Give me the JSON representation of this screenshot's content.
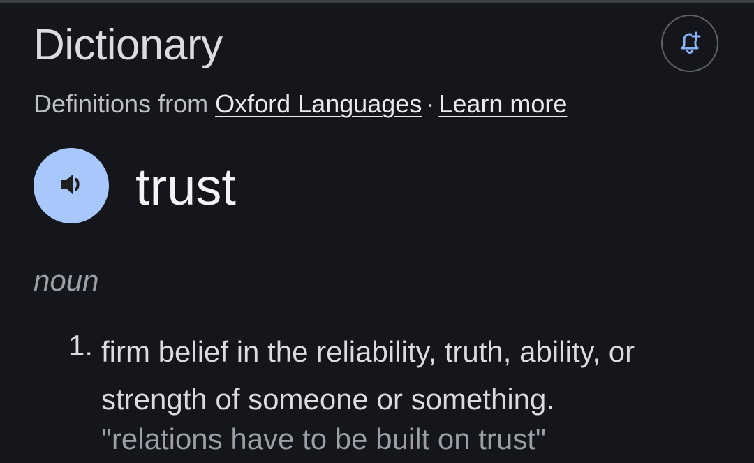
{
  "header": {
    "title": "Dictionary",
    "alert_icon": "bell-plus-icon"
  },
  "source": {
    "prefix": "Definitions from",
    "provider_link": "Oxford Languages",
    "separator": "·",
    "learn_more_link": "Learn more"
  },
  "entry": {
    "speaker_icon": "speaker-icon",
    "word": "trust",
    "part_of_speech": "noun",
    "senses": [
      {
        "number": "1.",
        "definition": "firm belief in the reliability, truth, ability, or strength of someone or something.",
        "example": "\"relations have to be built on trust\""
      }
    ]
  },
  "colors": {
    "background": "#15161b",
    "speaker_button": "#a8c7fa",
    "icon_accent": "#8ab4f8"
  }
}
